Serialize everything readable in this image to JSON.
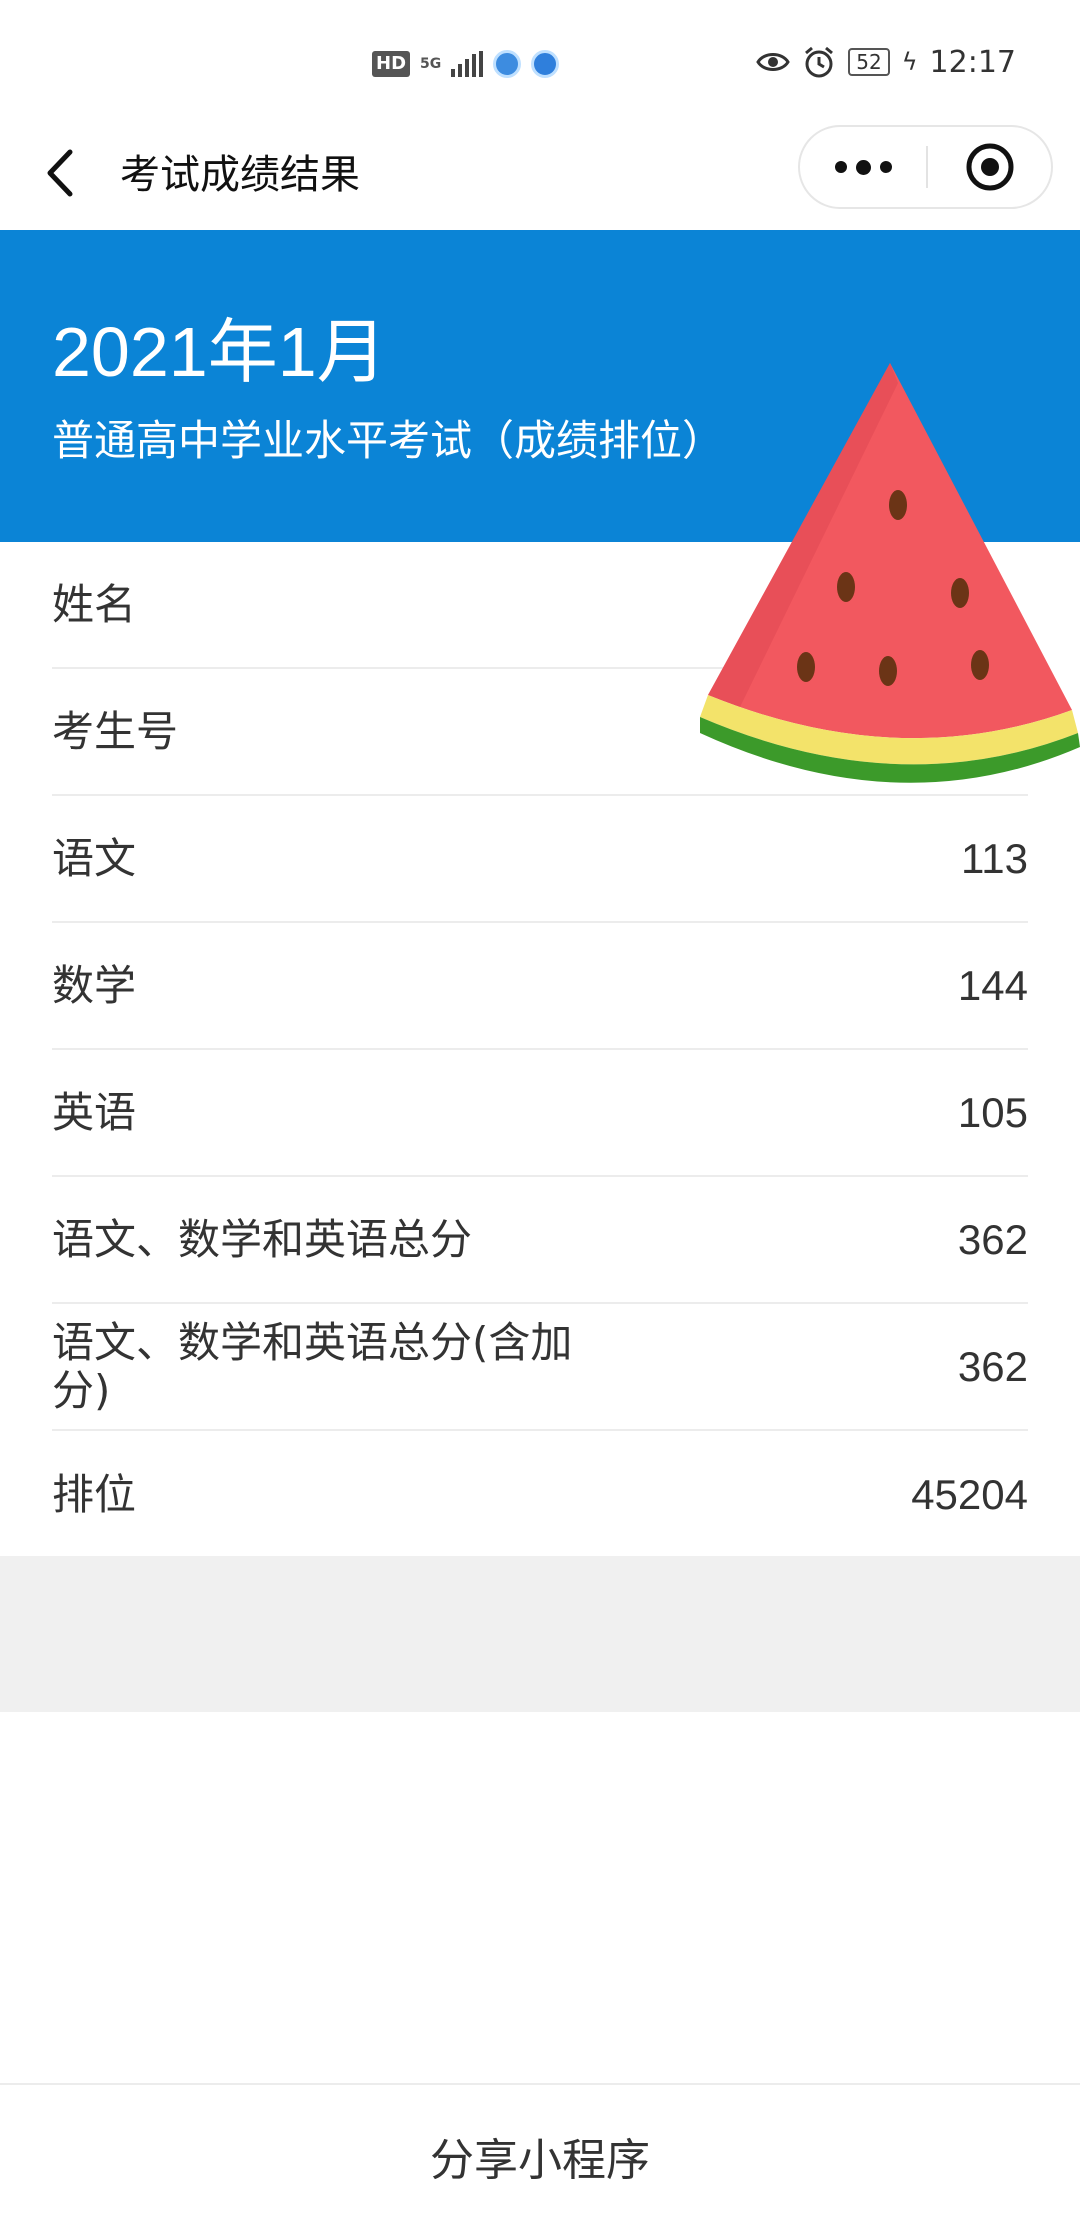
{
  "status_bar": {
    "network_badge": "HD",
    "network_type": "5G",
    "battery": "52",
    "time": "12:17"
  },
  "nav": {
    "title": "考试成绩结果"
  },
  "exam": {
    "date": "2021年1月",
    "name": "普通高中学业水平考试（成绩排位）"
  },
  "results": [
    {
      "label": "姓名",
      "value": ""
    },
    {
      "label": "考生号",
      "value": ""
    },
    {
      "label": "语文",
      "value": "113"
    },
    {
      "label": "数学",
      "value": "144"
    },
    {
      "label": "英语",
      "value": "105"
    },
    {
      "label": "语文、数学和英语总分",
      "value": "362"
    },
    {
      "label": "语文、数学和英语总分(含加分)",
      "value": "362"
    },
    {
      "label": "排位",
      "value": "45204"
    }
  ],
  "bottom": {
    "share_label": "分享小程序"
  },
  "colors": {
    "header_blue": "#0b84d6",
    "watermelon_red": "#f2585f",
    "rind_yellow": "#f3e36a",
    "rind_green": "#3c9a2a"
  }
}
